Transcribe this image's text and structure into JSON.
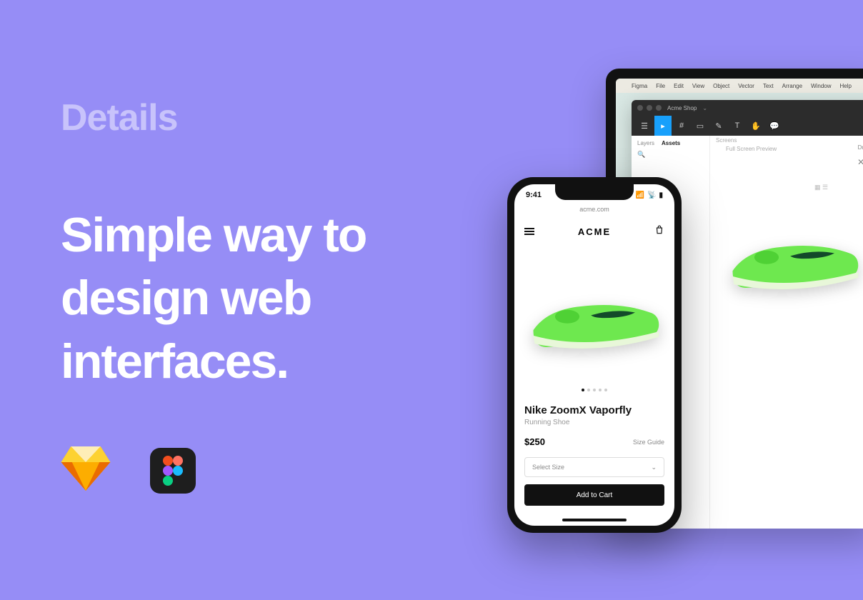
{
  "eyebrow": "Details",
  "headline": "Simple way to design web interfaces.",
  "laptop": {
    "mac_menu": [
      "Figma",
      "File",
      "Edit",
      "View",
      "Object",
      "Vector",
      "Text",
      "Arrange",
      "Window",
      "Help"
    ],
    "window_title": "Acme Shop",
    "side_tabs": {
      "layers": "Layers",
      "assets": "Assets"
    },
    "screens_label": "Screens",
    "canvas_label": "Full Screen Preview",
    "drafts": "Drafts"
  },
  "phone": {
    "time": "9:41",
    "url": "acme.com",
    "brand": "ACME",
    "product_name": "Nike ZoomX Vaporfly",
    "product_sub": "Running Shoe",
    "price": "$250",
    "size_guide": "Size Guide",
    "select_placeholder": "Select Size",
    "cta": "Add to Cart"
  }
}
